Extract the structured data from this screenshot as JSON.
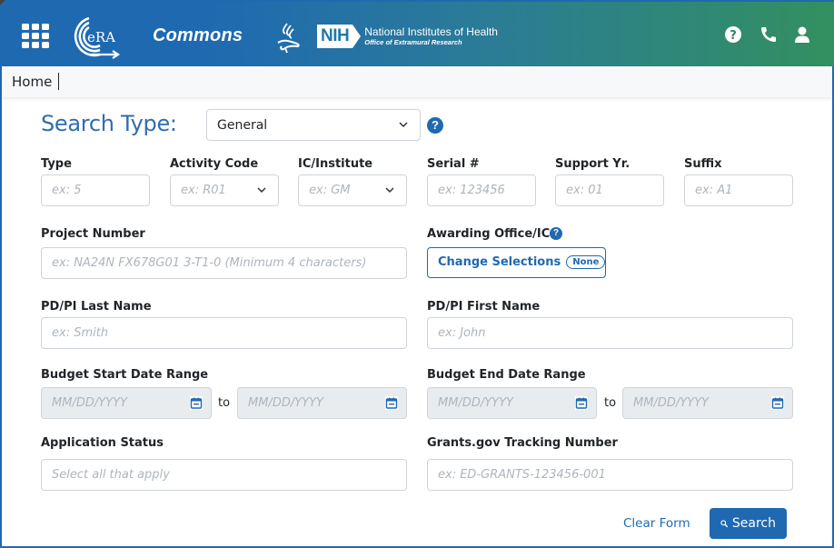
{
  "header": {
    "apps_icon": "grid-icon",
    "era_logo_text": "eRA",
    "app_name": "Commons",
    "nih_abbrev": "NIH",
    "nih_name": "National Institutes of Health",
    "nih_office": "Office of Extramural Research",
    "icons": [
      "help-icon",
      "phone-icon",
      "user-icon"
    ],
    "brand_color_start": "#1f69b1",
    "brand_color_end": "#33905f"
  },
  "breadcrumb": {
    "items": [
      "Home"
    ]
  },
  "search_type": {
    "label": "Search Type:",
    "selected": "General",
    "help": "?"
  },
  "fields": {
    "type": {
      "label": "Type",
      "placeholder": "ex: 5"
    },
    "activity_code": {
      "label": "Activity Code",
      "placeholder": "ex: R01"
    },
    "ic_institute": {
      "label": "IC/Institute",
      "placeholder": "ex: GM"
    },
    "serial": {
      "label": "Serial #",
      "placeholder": "ex: 123456"
    },
    "support_yr": {
      "label": "Support Yr.",
      "placeholder": "ex: 01"
    },
    "suffix": {
      "label": "Suffix",
      "placeholder": "ex: A1"
    },
    "project_number": {
      "label": "Project Number",
      "placeholder": "ex: NA24N FX678G01 3-T1-0 (Minimum 4 characters)"
    },
    "awarding_office": {
      "label": "Awarding Office/IC",
      "button_label": "Change Selections",
      "selection_badge": "None",
      "help": "?"
    },
    "pi_last": {
      "label": "PD/PI Last Name",
      "placeholder": "ex: Smith"
    },
    "pi_first": {
      "label": "PD/PI First Name",
      "placeholder": "ex: John"
    },
    "budget_start": {
      "label": "Budget Start Date Range",
      "from_placeholder": "MM/DD/YYYY",
      "to_label": "to",
      "to_placeholder": "MM/DD/YYYY"
    },
    "budget_end": {
      "label": "Budget End Date Range",
      "from_placeholder": "MM/DD/YYYY",
      "to_label": "to",
      "to_placeholder": "MM/DD/YYYY"
    },
    "app_status": {
      "label": "Application Status",
      "placeholder": "Select all that apply"
    },
    "grants_tracking": {
      "label": "Grants.gov Tracking Number",
      "placeholder": "ex: ED-GRANTS-123456-001"
    }
  },
  "actions": {
    "clear_label": "Clear Form",
    "search_label": "Search"
  }
}
